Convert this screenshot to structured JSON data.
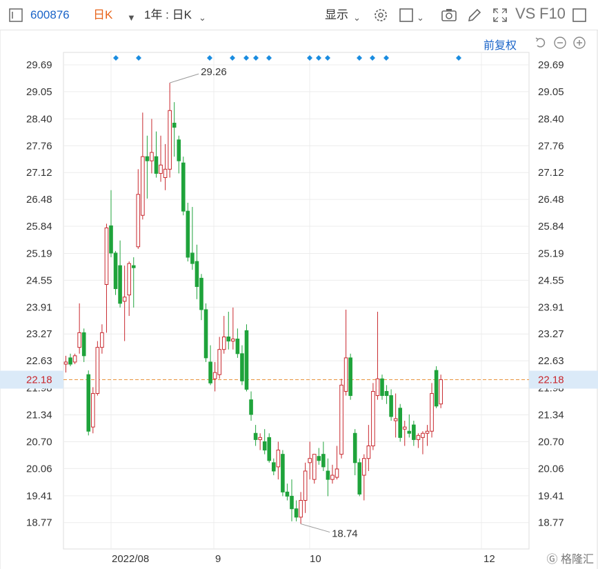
{
  "toolbar": {
    "code": "600876",
    "period": "日K",
    "range": "1年 : 日K",
    "display_label": "显示",
    "vs_label": "VS",
    "f10_label": "F10",
    "adjust_label": "前复权"
  },
  "icons": [
    "sidebar-toggle-icon",
    "gear-icon",
    "square-icon",
    "camera-icon",
    "pencil-icon",
    "fullscreen-icon",
    "undo-icon",
    "zoom-out-icon",
    "zoom-in-icon"
  ],
  "colors": {
    "up": "#c8262c",
    "down": "#1fa33b",
    "accent": "#1a64c8",
    "current_line": "#e8923a",
    "event_marker": "#1a8ce0"
  },
  "chart_data": {
    "type": "candlestick",
    "y_ticks": [
      "29.69",
      "29.05",
      "28.40",
      "27.76",
      "27.12",
      "26.48",
      "25.84",
      "25.19",
      "24.55",
      "23.91",
      "23.27",
      "22.63",
      "21.98",
      "21.34",
      "20.70",
      "20.06",
      "19.41",
      "18.77"
    ],
    "ylim": [
      18.45,
      30.05
    ],
    "x_tick_labels": [
      "2022/08",
      "9",
      "10",
      "12"
    ],
    "current_price": "22.18",
    "max_label": "29.26",
    "min_label": "18.74",
    "grid": true,
    "event_marker_count": 14,
    "candles": [
      {
        "o": 22.55,
        "h": 22.75,
        "l": 22.35,
        "c": 22.6
      },
      {
        "o": 22.7,
        "h": 22.8,
        "l": 22.5,
        "c": 22.55
      },
      {
        "o": 22.6,
        "h": 22.8,
        "l": 22.55,
        "c": 22.75
      },
      {
        "o": 22.95,
        "h": 24.0,
        "l": 22.8,
        "c": 23.3
      },
      {
        "o": 23.3,
        "h": 23.4,
        "l": 22.6,
        "c": 22.75
      },
      {
        "o": 22.3,
        "h": 22.4,
        "l": 20.85,
        "c": 20.95
      },
      {
        "o": 21.05,
        "h": 22.0,
        "l": 20.9,
        "c": 21.85
      },
      {
        "o": 21.85,
        "h": 23.1,
        "l": 21.8,
        "c": 22.95
      },
      {
        "o": 22.95,
        "h": 23.5,
        "l": 22.8,
        "c": 23.3
      },
      {
        "o": 24.45,
        "h": 25.9,
        "l": 23.3,
        "c": 25.8
      },
      {
        "o": 25.85,
        "h": 26.7,
        "l": 25.1,
        "c": 25.2
      },
      {
        "o": 25.2,
        "h": 25.25,
        "l": 24.2,
        "c": 24.35
      },
      {
        "o": 24.9,
        "h": 25.5,
        "l": 23.9,
        "c": 24.0
      },
      {
        "o": 24.05,
        "h": 24.9,
        "l": 23.1,
        "c": 24.15
      },
      {
        "o": 24.2,
        "h": 25.0,
        "l": 23.7,
        "c": 24.95
      },
      {
        "o": 24.9,
        "h": 25.1,
        "l": 23.9,
        "c": 24.85
      },
      {
        "o": 25.35,
        "h": 27.2,
        "l": 25.3,
        "c": 26.6
      },
      {
        "o": 26.1,
        "h": 28.55,
        "l": 26.0,
        "c": 27.5
      },
      {
        "o": 27.5,
        "h": 28.0,
        "l": 26.5,
        "c": 27.4
      },
      {
        "o": 27.4,
        "h": 28.4,
        "l": 27.1,
        "c": 27.6
      },
      {
        "o": 27.5,
        "h": 28.1,
        "l": 27.0,
        "c": 27.1
      },
      {
        "o": 27.1,
        "h": 28.0,
        "l": 26.9,
        "c": 27.3
      },
      {
        "o": 27.0,
        "h": 27.8,
        "l": 26.7,
        "c": 27.2
      },
      {
        "o": 27.2,
        "h": 29.26,
        "l": 27.0,
        "c": 28.6
      },
      {
        "o": 28.3,
        "h": 28.8,
        "l": 27.5,
        "c": 28.2
      },
      {
        "o": 27.9,
        "h": 28.0,
        "l": 27.1,
        "c": 27.4
      },
      {
        "o": 27.35,
        "h": 27.5,
        "l": 26.1,
        "c": 26.2
      },
      {
        "o": 26.2,
        "h": 26.4,
        "l": 25.0,
        "c": 25.1
      },
      {
        "o": 25.2,
        "h": 26.3,
        "l": 24.8,
        "c": 24.95
      },
      {
        "o": 25.0,
        "h": 25.4,
        "l": 24.1,
        "c": 24.4
      },
      {
        "o": 24.6,
        "h": 24.7,
        "l": 23.6,
        "c": 23.85
      },
      {
        "o": 23.85,
        "h": 24.0,
        "l": 22.6,
        "c": 22.7
      },
      {
        "o": 22.6,
        "h": 23.0,
        "l": 22.05,
        "c": 22.1
      },
      {
        "o": 22.2,
        "h": 22.6,
        "l": 21.9,
        "c": 22.35
      },
      {
        "o": 22.3,
        "h": 23.2,
        "l": 22.2,
        "c": 22.9
      },
      {
        "o": 22.9,
        "h": 23.7,
        "l": 22.8,
        "c": 23.2
      },
      {
        "o": 23.2,
        "h": 23.8,
        "l": 22.9,
        "c": 23.1
      },
      {
        "o": 23.1,
        "h": 23.9,
        "l": 22.9,
        "c": 23.15
      },
      {
        "o": 23.15,
        "h": 23.4,
        "l": 22.7,
        "c": 22.8
      },
      {
        "o": 22.8,
        "h": 23.0,
        "l": 22.05,
        "c": 22.15
      },
      {
        "o": 23.35,
        "h": 23.5,
        "l": 21.9,
        "c": 21.95
      },
      {
        "o": 21.7,
        "h": 21.9,
        "l": 21.2,
        "c": 21.35
      },
      {
        "o": 20.9,
        "h": 21.1,
        "l": 20.6,
        "c": 20.75
      },
      {
        "o": 20.75,
        "h": 20.9,
        "l": 20.5,
        "c": 20.8
      },
      {
        "o": 20.7,
        "h": 21.0,
        "l": 20.4,
        "c": 20.5
      },
      {
        "o": 20.8,
        "h": 20.9,
        "l": 20.2,
        "c": 20.25
      },
      {
        "o": 20.2,
        "h": 20.3,
        "l": 19.9,
        "c": 20.0
      },
      {
        "o": 20.1,
        "h": 20.7,
        "l": 19.8,
        "c": 20.5
      },
      {
        "o": 20.4,
        "h": 20.5,
        "l": 19.4,
        "c": 19.5
      },
      {
        "o": 19.5,
        "h": 19.7,
        "l": 19.3,
        "c": 19.4
      },
      {
        "o": 19.4,
        "h": 19.8,
        "l": 18.8,
        "c": 19.1
      },
      {
        "o": 19.1,
        "h": 19.3,
        "l": 18.8,
        "c": 18.9
      },
      {
        "o": 18.9,
        "h": 19.5,
        "l": 18.74,
        "c": 19.3
      },
      {
        "o": 19.3,
        "h": 20.2,
        "l": 19.0,
        "c": 20.0
      },
      {
        "o": 20.2,
        "h": 20.7,
        "l": 19.8,
        "c": 20.3
      },
      {
        "o": 19.8,
        "h": 20.4,
        "l": 19.7,
        "c": 20.4
      },
      {
        "o": 20.35,
        "h": 20.55,
        "l": 20.15,
        "c": 20.25
      },
      {
        "o": 20.4,
        "h": 20.7,
        "l": 20.0,
        "c": 20.1
      },
      {
        "o": 20.0,
        "h": 20.3,
        "l": 19.4,
        "c": 19.8
      },
      {
        "o": 19.8,
        "h": 20.15,
        "l": 19.7,
        "c": 19.9
      },
      {
        "o": 19.85,
        "h": 20.6,
        "l": 19.8,
        "c": 20.05
      },
      {
        "o": 20.4,
        "h": 22.2,
        "l": 20.3,
        "c": 22.05
      },
      {
        "o": 21.9,
        "h": 23.85,
        "l": 21.8,
        "c": 22.7
      },
      {
        "o": 22.7,
        "h": 22.8,
        "l": 21.7,
        "c": 21.8
      },
      {
        "o": 20.9,
        "h": 21.0,
        "l": 19.9,
        "c": 20.2
      },
      {
        "o": 20.2,
        "h": 20.3,
        "l": 19.4,
        "c": 19.45
      },
      {
        "o": 19.9,
        "h": 20.4,
        "l": 19.3,
        "c": 20.3
      },
      {
        "o": 20.3,
        "h": 21.1,
        "l": 20.0,
        "c": 20.6
      },
      {
        "o": 20.6,
        "h": 22.1,
        "l": 20.5,
        "c": 21.9
      },
      {
        "o": 21.8,
        "h": 23.8,
        "l": 21.7,
        "c": 22.2
      },
      {
        "o": 22.2,
        "h": 22.3,
        "l": 21.7,
        "c": 21.8
      },
      {
        "o": 21.9,
        "h": 22.05,
        "l": 21.6,
        "c": 21.8
      },
      {
        "o": 21.8,
        "h": 21.95,
        "l": 21.2,
        "c": 21.3
      },
      {
        "o": 21.2,
        "h": 21.85,
        "l": 20.8,
        "c": 21.25
      },
      {
        "o": 21.5,
        "h": 21.6,
        "l": 20.7,
        "c": 20.8
      },
      {
        "o": 21.0,
        "h": 21.2,
        "l": 20.6,
        "c": 21.05
      },
      {
        "o": 20.95,
        "h": 21.35,
        "l": 20.8,
        "c": 20.9
      },
      {
        "o": 21.1,
        "h": 21.2,
        "l": 20.6,
        "c": 20.75
      },
      {
        "o": 20.75,
        "h": 20.9,
        "l": 20.55,
        "c": 20.85
      },
      {
        "o": 20.8,
        "h": 20.95,
        "l": 20.4,
        "c": 20.9
      },
      {
        "o": 20.9,
        "h": 21.1,
        "l": 20.6,
        "c": 20.95
      },
      {
        "o": 20.95,
        "h": 22.1,
        "l": 20.8,
        "c": 21.85
      },
      {
        "o": 22.4,
        "h": 22.5,
        "l": 21.5,
        "c": 21.55
      },
      {
        "o": 21.6,
        "h": 22.3,
        "l": 21.5,
        "c": 22.18
      }
    ]
  }
}
